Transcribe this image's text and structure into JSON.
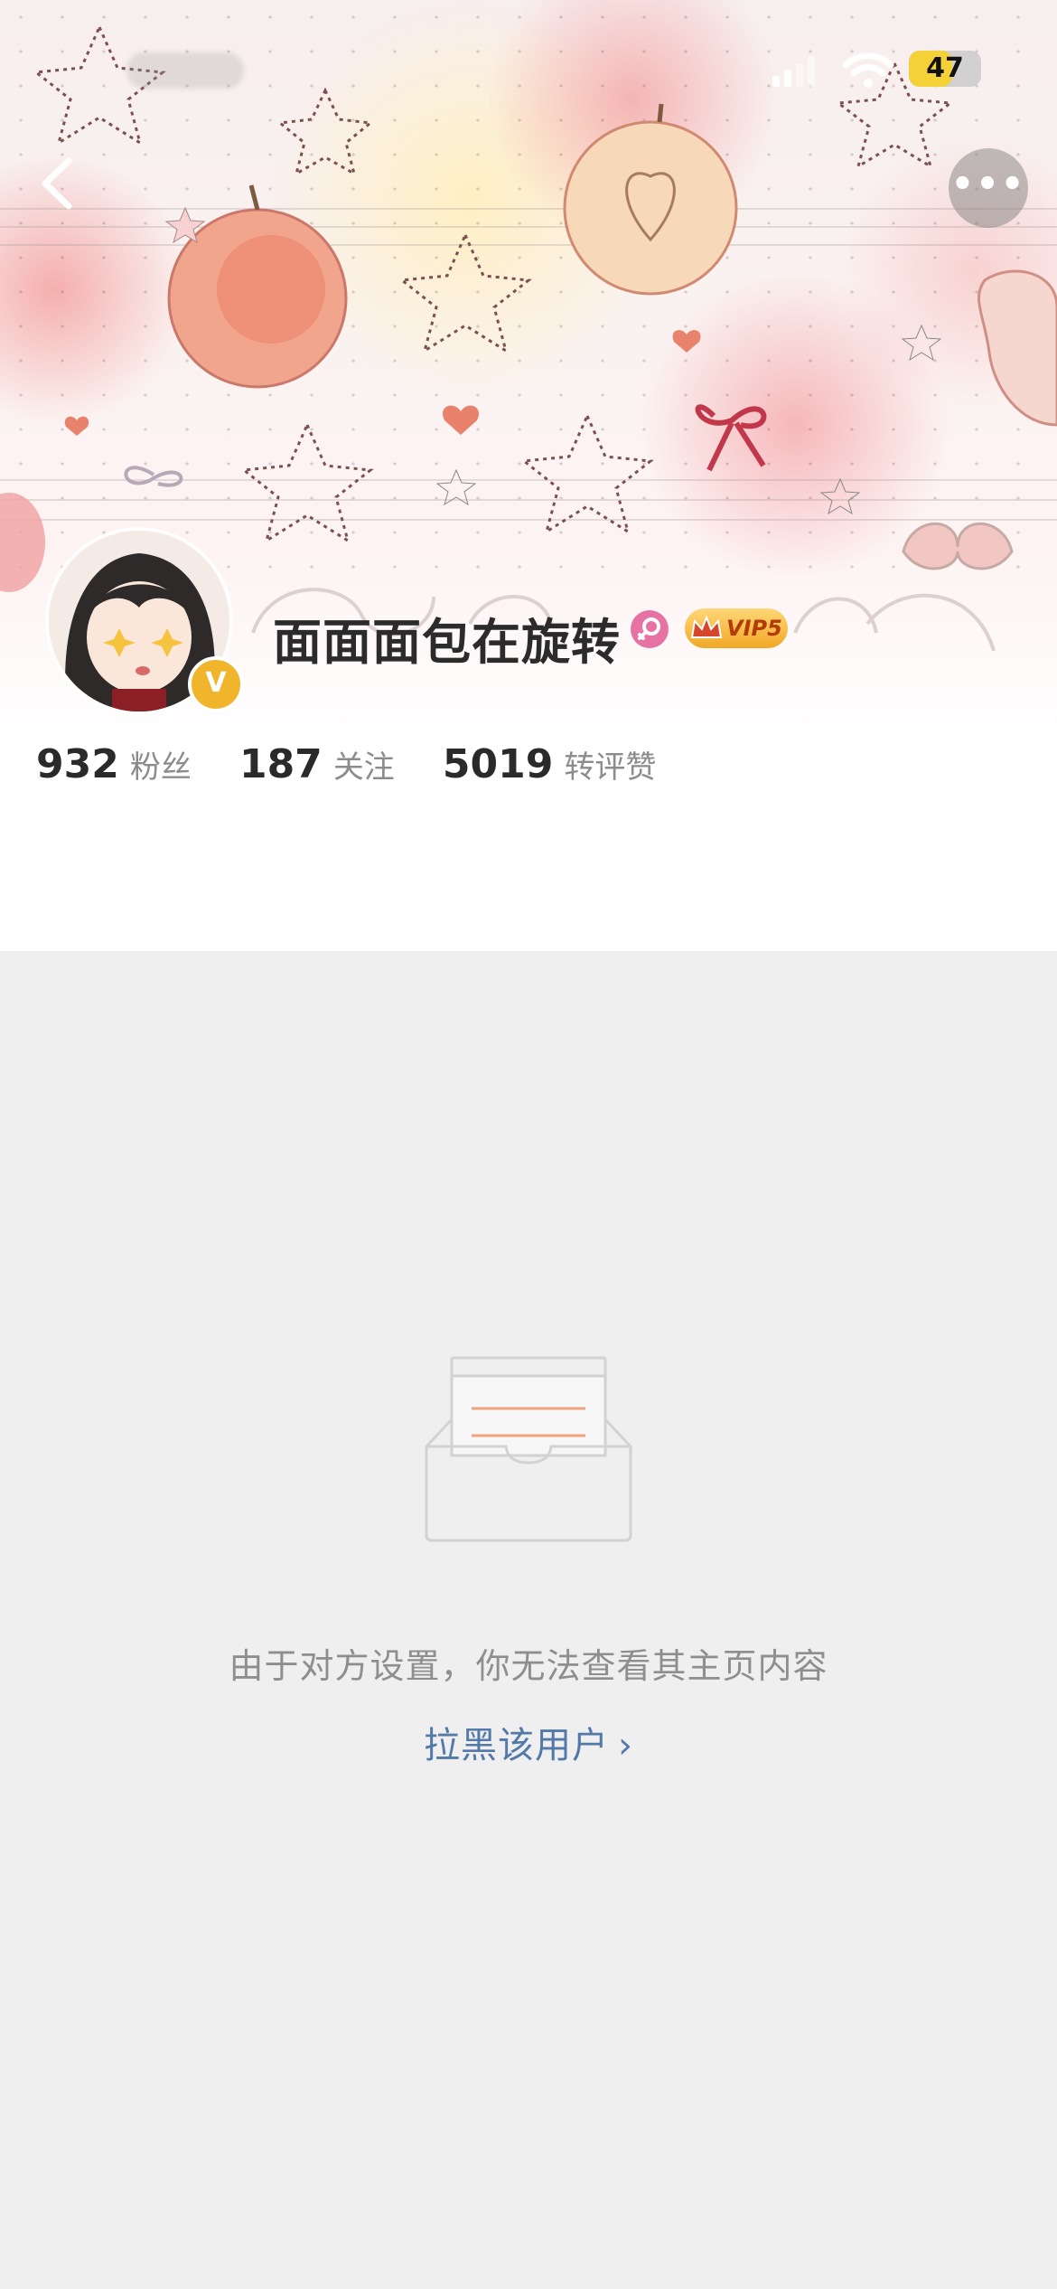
{
  "status_bar": {
    "battery": "47"
  },
  "profile": {
    "username": "面面面包在旋转",
    "vip_label": "VIP5",
    "stats": [
      {
        "value": "932",
        "label": "粉丝"
      },
      {
        "value": "187",
        "label": "关注"
      },
      {
        "value": "5019",
        "label": "转评赞"
      }
    ]
  },
  "empty_state": {
    "message": "由于对方设置，你无法查看其主页内容",
    "block_link": "拉黑该用户"
  },
  "icons": {
    "back": "chevron-left-icon",
    "more": "more-icon",
    "verified": "verified-badge-icon",
    "gender": "female-icon",
    "vip": "crown-icon",
    "link": "chevron-right-icon",
    "empty": "empty-inbox-icon"
  },
  "colors": {
    "background": "#efefef",
    "link": "#5379a8",
    "verified": "#f0b52b",
    "vip_gold": "#f0a826",
    "gender_pink": "#e773a4"
  }
}
